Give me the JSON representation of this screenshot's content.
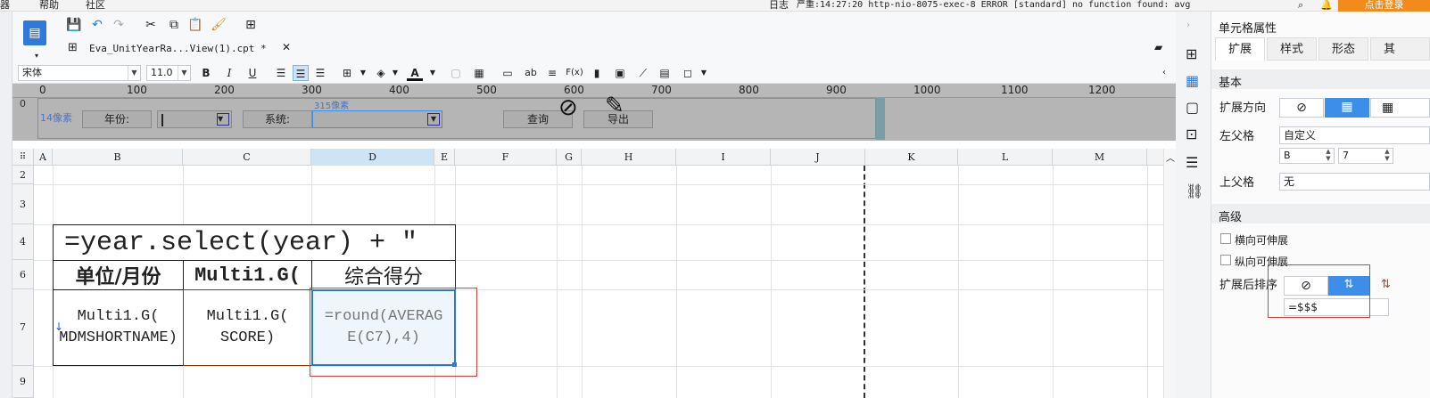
{
  "menubar": {
    "items": [
      "器",
      "帮助",
      "社区"
    ],
    "log_label": "日志",
    "log_message": "严重:14:27:20 http-nio-8075-exec-8 ERROR [standard] no function found: avg",
    "login_label": "点击登录"
  },
  "tab": {
    "title": "Eva_UnitYearRa...View(1).cpt *"
  },
  "format": {
    "font_family": "宋体",
    "font_size": "11.0",
    "bold": "B",
    "italic": "I",
    "underline": "U",
    "abc": "ab",
    "fx": "F(x)"
  },
  "ruler": {
    "zero": "0",
    "left_zero": "0",
    "marks": [
      "0",
      "100",
      "200",
      "300",
      "400",
      "500",
      "600",
      "700",
      "800",
      "900",
      "1000",
      "1100",
      "1200"
    ]
  },
  "param_pane": {
    "left_px": "14像素",
    "width_px": "315像素",
    "year_label": "年份:",
    "system_label": "系统:",
    "query_label": "查询",
    "export_label": "导出"
  },
  "sheet": {
    "columns": [
      "A",
      "B",
      "C",
      "D",
      "E",
      "F",
      "G",
      "H",
      "I",
      "J",
      "K",
      "L",
      "M"
    ],
    "rows": [
      "2",
      "3",
      "4",
      "6",
      "7",
      "9"
    ],
    "cell_b4": "=year.select(year) + \"",
    "cell_b6": "单位/月份",
    "cell_c6": "Multi1.G(",
    "cell_d6": "综合得分",
    "cell_b7": "Multi1.G(\nMDMSHORTNAME)",
    "cell_c7": "Multi1.G(\nSCORE)",
    "cell_d7": "=round(AVERAG\nE(C7),4)"
  },
  "right_panel": {
    "title": "单元格属性",
    "tabs": [
      "扩展",
      "样式",
      "形态",
      "其"
    ],
    "basic_section": "基本",
    "expand_dir_label": "扩展方向",
    "left_parent_label": "左父格",
    "left_parent_value": "自定义",
    "left_parent_col": "B",
    "left_parent_row": "7",
    "upper_parent_label": "上父格",
    "upper_parent_value": "无",
    "advanced_section": "高级",
    "h_extend_label": "横向可伸展",
    "v_extend_label": "纵向可伸展",
    "sort_label": "扩展后排序",
    "sort_formula": "=$$$"
  },
  "colors": {
    "accent": "#3d8ee8",
    "selection": "#2b79d6",
    "highlight_red": "#e53935",
    "param_bg": "#b5b5b5"
  }
}
